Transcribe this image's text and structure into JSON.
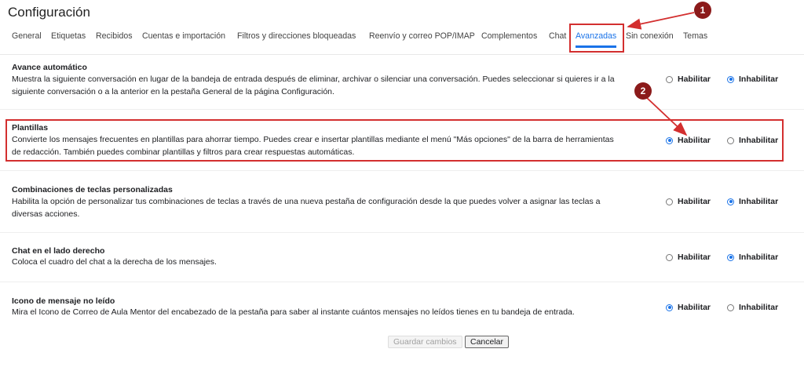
{
  "page_title": "Configuración",
  "tabs": [
    {
      "label": "General"
    },
    {
      "label": "Etiquetas"
    },
    {
      "label": "Recibidos"
    },
    {
      "label": "Cuentas e importación"
    },
    {
      "label": "Filtros y direcciones bloqueadas"
    },
    {
      "label": "Reenvío y correo POP/IMAP"
    },
    {
      "label": "Complementos"
    },
    {
      "label": "Chat"
    },
    {
      "label": "Avanzadas"
    },
    {
      "label": "Sin conexión"
    },
    {
      "label": "Temas"
    }
  ],
  "active_tab": "Avanzadas",
  "settings": [
    {
      "title": "Avance automático",
      "description": "Muestra la siguiente conversación en lugar de la bandeja de entrada después de eliminar, archivar o silenciar una conversación. Puedes seleccionar si quieres ir a la siguiente conversación o a la anterior en la pestaña General de la página Configuración.",
      "enable_label": "Habilitar",
      "disable_label": "Inhabilitar",
      "selected": "disable"
    },
    {
      "title": "Plantillas",
      "description": "Convierte los mensajes frecuentes en plantillas para ahorrar tiempo. Puedes crear e insertar plantillas mediante el menú \"Más opciones\" de la barra de herramientas de redacción. También puedes combinar plantillas y filtros para crear respuestas automáticas.",
      "enable_label": "Habilitar",
      "disable_label": "Inhabilitar",
      "selected": "enable"
    },
    {
      "title": "Combinaciones de teclas personalizadas",
      "description": "Habilita la opción de personalizar tus combinaciones de teclas a través de una nueva pestaña de configuración desde la que puedes volver a asignar las teclas a diversas acciones.",
      "enable_label": "Habilitar",
      "disable_label": "Inhabilitar",
      "selected": "disable"
    },
    {
      "title": "Chat en el lado derecho",
      "description": "Coloca el cuadro del chat a la derecha de los mensajes.",
      "enable_label": "Habilitar",
      "disable_label": "Inhabilitar",
      "selected": "disable"
    },
    {
      "title": "Icono de mensaje no leído",
      "description": "Mira el Icono de Correo de Aula Mentor del encabezado de la pestaña para saber al instante cuántos mensajes no leídos tienes en tu bandeja de entrada.",
      "enable_label": "Habilitar",
      "disable_label": "Inhabilitar",
      "selected": "enable"
    }
  ],
  "buttons": {
    "save_label": "Guardar cambios",
    "cancel_label": "Cancelar"
  },
  "annotations": {
    "marker_1": "1",
    "marker_2": "2"
  },
  "colors": {
    "accent": "#1a73e8",
    "highlight": "#d32f2f",
    "marker": "#8b1a1a"
  }
}
